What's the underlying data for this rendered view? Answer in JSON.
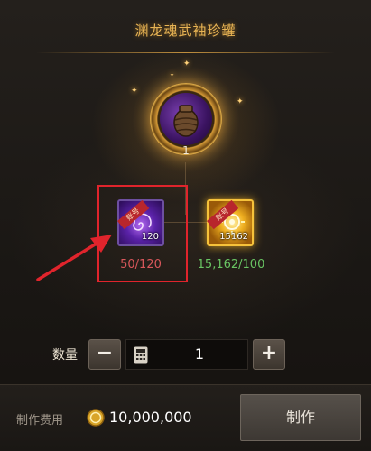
{
  "title": "渊龙魂武袖珍罐",
  "result": {
    "icon": "purple-orb-jar-icon",
    "count": "1"
  },
  "materials": [
    {
      "icon": "purple-swirl-item-icon",
      "badge": "账号",
      "quantity_on_icon": "120",
      "requirement": "50/120",
      "requirement_color": "#d9575b",
      "highlighted": true
    },
    {
      "icon": "golden-sun-item-icon",
      "badge": "账号",
      "quantity_on_icon": "15162",
      "requirement": "15,162/100",
      "requirement_color": "#69c463",
      "highlighted": false
    }
  ],
  "quantity": {
    "label": "数量",
    "value": "1",
    "minus_icon": "minus-icon",
    "plus_icon": "plus-icon",
    "calculator_icon": "calculator-icon"
  },
  "cost": {
    "label": "制作费用",
    "currency_icon": "gold-coin-icon",
    "value": "10,000,000"
  },
  "make_button": "制作",
  "colors": {
    "title": "#e8b454",
    "insufficient": "#d9575b",
    "sufficient": "#69c463",
    "highlight_box": "#e0242c"
  }
}
